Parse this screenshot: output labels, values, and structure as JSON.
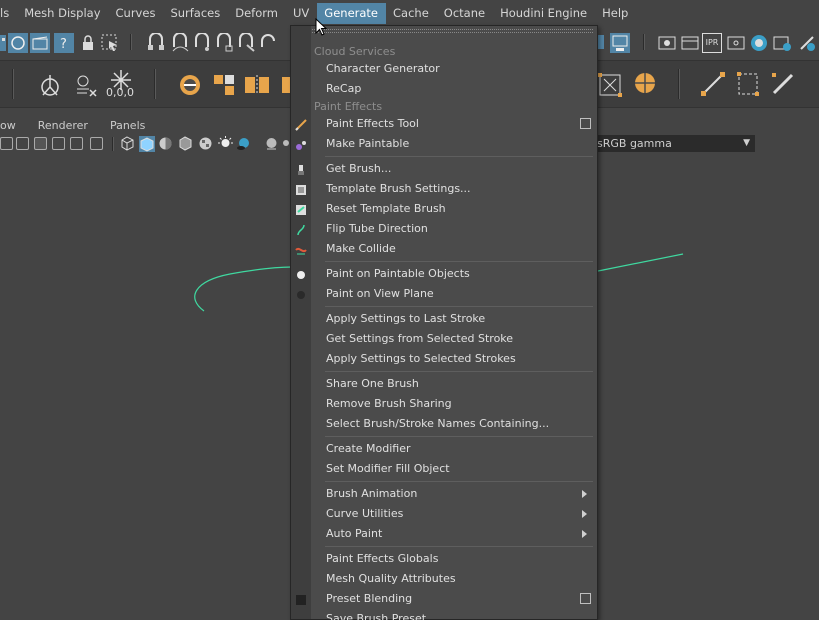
{
  "menubar": {
    "items": [
      "ls",
      "Mesh Display",
      "Curves",
      "Surfaces",
      "Deform",
      "UV",
      "Generate",
      "Cache",
      "Octane",
      "Houdini Engine",
      "Help"
    ],
    "active_index": 6
  },
  "shelf": {
    "pivot_readout": "0,0,0",
    "toolbar_label_ipr": "IPR"
  },
  "panel": {
    "menus": [
      "ow",
      "Renderer",
      "Panels"
    ],
    "color_space": "sRGB gamma"
  },
  "generate_menu": {
    "sections": {
      "cloud_services": "Cloud Services",
      "paint_effects": "Paint Effects"
    },
    "items": {
      "character_generator": "Character Generator",
      "recap": "ReCap",
      "paint_effects_tool": "Paint Effects Tool",
      "make_paintable": "Make Paintable",
      "get_brush": "Get Brush...",
      "template_brush_settings": "Template Brush Settings...",
      "reset_template_brush": "Reset Template Brush",
      "flip_tube_direction": "Flip Tube Direction",
      "make_collide": "Make Collide",
      "paint_on_paintable_objects": "Paint on Paintable Objects",
      "paint_on_view_plane": "Paint on View Plane",
      "apply_settings_last_stroke": "Apply Settings to Last Stroke",
      "get_settings_selected_stroke": "Get Settings from Selected Stroke",
      "apply_settings_selected_strokes": "Apply Settings to Selected Strokes",
      "share_one_brush": "Share One Brush",
      "remove_brush_sharing": "Remove Brush Sharing",
      "select_brush_stroke_names": "Select Brush/Stroke Names Containing...",
      "create_modifier": "Create Modifier",
      "set_modifier_fill_object": "Set Modifier Fill Object",
      "brush_animation": "Brush Animation",
      "curve_utilities": "Curve Utilities",
      "auto_paint": "Auto Paint",
      "paint_effects_globals": "Paint Effects Globals",
      "mesh_quality_attributes": "Mesh Quality Attributes",
      "preset_blending": "Preset Blending",
      "save_brush_preset": "Save Brush Preset..."
    }
  },
  "colors": {
    "accent": "#5285a6",
    "curve": "#3fd9a0",
    "menu_bg": "#4b4b4b",
    "ui_bg": "#444444"
  }
}
